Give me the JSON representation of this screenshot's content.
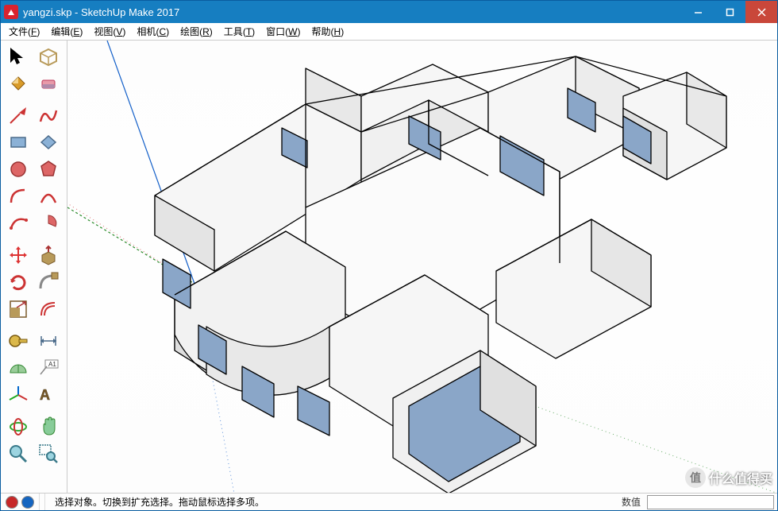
{
  "title": "yangzi.skp - SketchUp Make 2017",
  "menubar": [
    {
      "label": "文件",
      "u": "F"
    },
    {
      "label": "编辑",
      "u": "E"
    },
    {
      "label": "视图",
      "u": "V"
    },
    {
      "label": "相机",
      "u": "C"
    },
    {
      "label": "绘图",
      "u": "R"
    },
    {
      "label": "工具",
      "u": "T"
    },
    {
      "label": "窗口",
      "u": "W"
    },
    {
      "label": "帮助",
      "u": "H"
    }
  ],
  "tools": {
    "row1": {
      "a": "select-icon",
      "b": "make-component-icon"
    },
    "row2": {
      "a": "paint-bucket-icon",
      "b": "eraser-icon"
    },
    "row3": {
      "a": "line-icon",
      "b": "freehand-icon"
    },
    "row4": {
      "a": "rectangle-icon",
      "b": "rotated-rectangle-icon"
    },
    "row5": {
      "a": "circle-icon",
      "b": "polygon-icon"
    },
    "row6": {
      "a": "arc-icon",
      "b": "arc2pt-icon"
    },
    "row7": {
      "a": "arc3pt-icon",
      "b": "pie-icon"
    },
    "row8": {
      "a": "move-icon",
      "b": "push-pull-icon"
    },
    "row9": {
      "a": "rotate-icon",
      "b": "followme-icon"
    },
    "row10": {
      "a": "scale-icon",
      "b": "offset-icon"
    },
    "row11": {
      "a": "tape-measure-icon",
      "b": "dimension-icon"
    },
    "row12": {
      "a": "protractor-icon",
      "b": "text-icon"
    },
    "row13": {
      "a": "axes-icon",
      "b": "3dtext-icon"
    },
    "row14": {
      "a": "orbit-icon",
      "b": "pan-icon"
    },
    "row15": {
      "a": "zoom-icon",
      "b": "zoom-window-icon"
    }
  },
  "status": {
    "hint": "选择对象。切换到扩充选择。拖动鼠标选择多项。",
    "measure_label": "数值"
  },
  "watermark": "什么值得买"
}
